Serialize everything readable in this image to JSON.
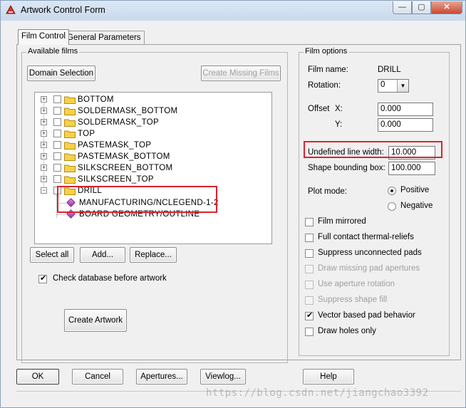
{
  "window": {
    "title": "Artwork Control Form",
    "minimize": "—",
    "maximize": "▢",
    "close": "✕"
  },
  "tabs": [
    {
      "label": "Film Control",
      "active": true
    },
    {
      "label": "General Parameters",
      "active": false
    }
  ],
  "available_films": {
    "title": "Available films",
    "domain_selection": "Domain Selection",
    "create_missing_films": "Create Missing Films",
    "films": [
      {
        "name": "BOTTOM",
        "expander": "+",
        "checked": false
      },
      {
        "name": "SOLDERMASK_BOTTOM",
        "expander": "+",
        "checked": false
      },
      {
        "name": "SOLDERMASK_TOP",
        "expander": "+",
        "checked": false
      },
      {
        "name": "TOP",
        "expander": "+",
        "checked": false
      },
      {
        "name": "PASTEMASK_TOP",
        "expander": "+",
        "checked": false
      },
      {
        "name": "PASTEMASK_BOTTOM",
        "expander": "+",
        "checked": false
      },
      {
        "name": "SILKSCREEN_BOTTOM",
        "expander": "+",
        "checked": false
      },
      {
        "name": "SILKSCREEN_TOP",
        "expander": "+",
        "checked": false
      },
      {
        "name": "DRILL",
        "expander": "−",
        "checked": false
      }
    ],
    "drill_children": [
      "MANUFACTURING/NCLEGEND-1-2",
      "BOARD GEOMETRY/OUTLINE"
    ],
    "select_all": "Select all",
    "add": "Add...",
    "replace": "Replace...",
    "check_database": {
      "label": "Check database before artwork",
      "checked": true
    },
    "create_artwork": "Create Artwork"
  },
  "film_options": {
    "title": "Film options",
    "film_name_label": "Film name:",
    "film_name_value": "DRILL",
    "rotation_label": "Rotation:",
    "rotation_value": "0",
    "offset_label": "Offset",
    "offset_x_label": "X:",
    "offset_x_value": "0.000",
    "offset_y_label": "Y:",
    "offset_y_value": "0.000",
    "undefined_line_width_label": "Undefined line width:",
    "undefined_line_width_value": "10.000",
    "shape_bounding_box_label": "Shape bounding box:",
    "shape_bounding_box_value": "100.000",
    "plot_mode_label": "Plot mode:",
    "plot_mode_positive": "Positive",
    "plot_mode_negative": "Negative",
    "plot_mode_selected": "Positive",
    "options": [
      {
        "label": "Film mirrored",
        "checked": false,
        "enabled": true
      },
      {
        "label": "Full contact thermal-reliefs",
        "checked": false,
        "enabled": true
      },
      {
        "label": "Suppress unconnected pads",
        "checked": false,
        "enabled": true
      },
      {
        "label": "Draw missing pad apertures",
        "checked": false,
        "enabled": false
      },
      {
        "label": "Use aperture rotation",
        "checked": false,
        "enabled": false
      },
      {
        "label": "Suppress shape fill",
        "checked": false,
        "enabled": false
      },
      {
        "label": "Vector based pad behavior",
        "checked": true,
        "enabled": true
      },
      {
        "label": "Draw holes only",
        "checked": false,
        "enabled": true
      }
    ]
  },
  "bottom_buttons": {
    "ok": "OK",
    "cancel": "Cancel",
    "apertures": "Apertures...",
    "viewlog": "Viewlog...",
    "help": "Help"
  },
  "watermark": "https://blog.csdn.net/jiangchao3392",
  "colors": {
    "highlight_box": "#d9232d",
    "folder": "#f7d14a",
    "layer_diamond": "#b63ab8"
  }
}
